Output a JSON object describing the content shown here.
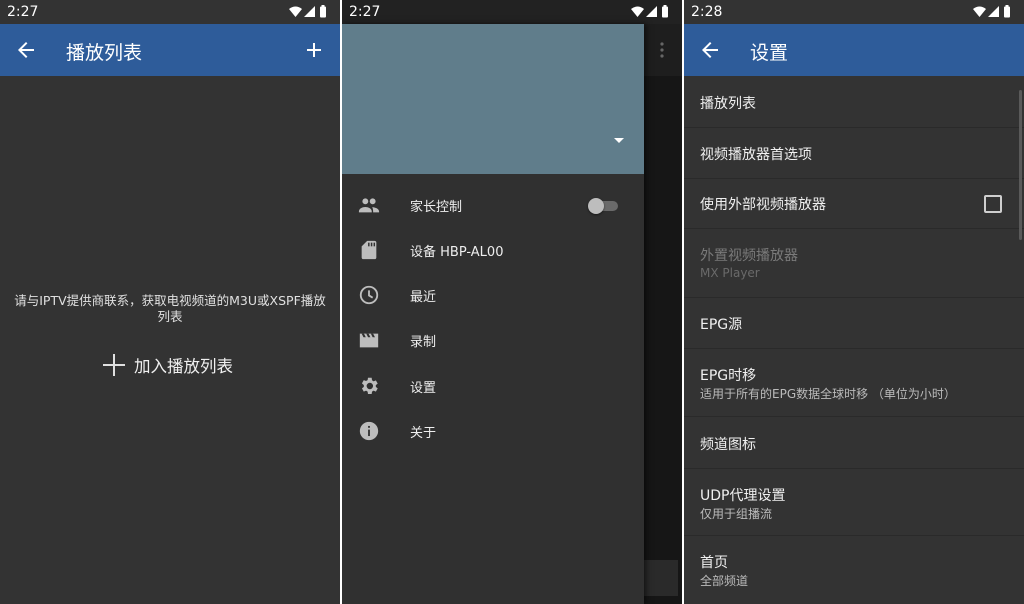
{
  "colors": {
    "appbar": "#2e5c9a",
    "drawer_header": "#607d8b",
    "background": "#333333"
  },
  "panel1": {
    "status_time": "2:27",
    "title": "播放列表",
    "hint": "请与IPTV提供商联系，获取电视频道的M3U或XSPF播放列表",
    "add_label": "加入播放列表"
  },
  "panel2": {
    "status_time": "2:27",
    "nav": [
      {
        "label": "家长控制",
        "icon": "people-icon"
      },
      {
        "label": "设备 HBP-AL00",
        "icon": "sd-card-icon"
      },
      {
        "label": "最近",
        "icon": "clock-icon"
      },
      {
        "label": "录制",
        "icon": "movie-icon"
      },
      {
        "label": "设置",
        "icon": "gear-icon"
      },
      {
        "label": "关于",
        "icon": "info-icon"
      }
    ],
    "parental_toggle": "off"
  },
  "panel3": {
    "status_time": "2:28",
    "title": "设置",
    "items": [
      {
        "title": "播放列表"
      },
      {
        "title": "视频播放器首选项"
      },
      {
        "title": "使用外部视频播放器",
        "checkbox": "unchecked"
      },
      {
        "title": "外置视频播放器",
        "subtitle": "MX Player",
        "disabled": true
      },
      {
        "title": "EPG源"
      },
      {
        "title": "EPG时移",
        "subtitle": "适用于所有的EPG数据全球时移 （单位为小时）"
      },
      {
        "title": "频道图标"
      },
      {
        "title": "UDP代理设置",
        "subtitle": "仅用于组播流"
      },
      {
        "title": "首页",
        "subtitle": "全部频道"
      }
    ]
  }
}
